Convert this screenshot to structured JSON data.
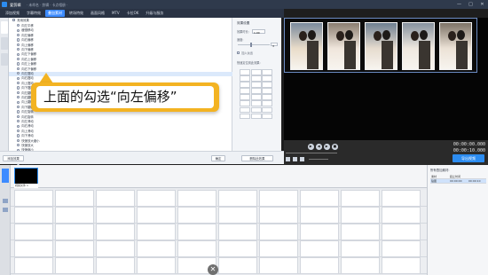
{
  "app": {
    "name": "爱剪辑",
    "title_sub": "· 未命名 · 剪辑 · 卡点相册 ·",
    "window_buttons": [
      "—",
      "□",
      "✕"
    ]
  },
  "menu": {
    "items": [
      "添加视频",
      "字幕特效",
      "叠加素材",
      "转场特效",
      "画面风格",
      "MTV",
      "卡拉OK",
      "升级与服务"
    ],
    "active_index": 2
  },
  "effects_list": {
    "category_label": "常用效果",
    "items": [
      "向左平移",
      "缓慢移动",
      "向左偏移",
      "向右偏移",
      "向上偏移",
      "向下偏移",
      "向左下偏移",
      "向右上偏移",
      "向左上偏移",
      "向右下偏移",
      "向左摆动",
      "向右摆动",
      "向上摆动",
      "向下摆动",
      "向左翻转",
      "向右翻转",
      "向上翻转",
      "向下翻转",
      "向左旋转",
      "向右旋转",
      "向左滑动",
      "向右滑动",
      "向上滑动",
      "向下滑动",
      "快速放大缩小",
      "快速放大",
      "快速缩小",
      "逐渐放大",
      "逐渐缩小",
      "左右闪动"
    ],
    "selected_index": 10
  },
  "callout": {
    "text": "上面的勾选“向左偏移”"
  },
  "settings": {
    "title": "效果设置",
    "duration_label": "效果时长:",
    "duration_value": "1.00",
    "speed_label": "速度:",
    "speed_value": "3",
    "option1_label": "加入淡出",
    "option2_label": "快速定位到此效果:"
  },
  "panel_buttons": {
    "add": "添加效果",
    "confirm": "确定",
    "delete": "删除此效果"
  },
  "preview": {
    "time_current": "00:00:00.000",
    "time_total": "00:00:10.000",
    "export_label": "导出视频"
  },
  "timeline": {
    "clip_label": "视频文件 1"
  },
  "right_panel": {
    "title": "所有叠加素材:",
    "headers": [
      "素材",
      "起止时间",
      ""
    ],
    "rows": [
      [
        "贴图",
        "00:00:00",
        "00:00:10"
      ]
    ]
  }
}
